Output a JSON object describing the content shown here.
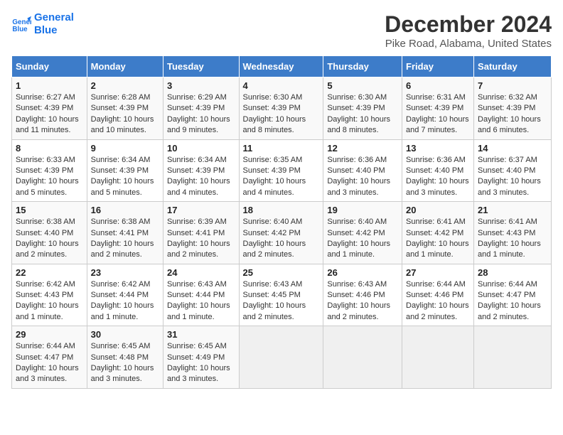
{
  "header": {
    "logo_line1": "General",
    "logo_line2": "Blue",
    "title": "December 2024",
    "subtitle": "Pike Road, Alabama, United States"
  },
  "days_of_week": [
    "Sunday",
    "Monday",
    "Tuesday",
    "Wednesday",
    "Thursday",
    "Friday",
    "Saturday"
  ],
  "weeks": [
    [
      {
        "day": "1",
        "info": "Sunrise: 6:27 AM\nSunset: 4:39 PM\nDaylight: 10 hours and 11 minutes."
      },
      {
        "day": "2",
        "info": "Sunrise: 6:28 AM\nSunset: 4:39 PM\nDaylight: 10 hours and 10 minutes."
      },
      {
        "day": "3",
        "info": "Sunrise: 6:29 AM\nSunset: 4:39 PM\nDaylight: 10 hours and 9 minutes."
      },
      {
        "day": "4",
        "info": "Sunrise: 6:30 AM\nSunset: 4:39 PM\nDaylight: 10 hours and 8 minutes."
      },
      {
        "day": "5",
        "info": "Sunrise: 6:30 AM\nSunset: 4:39 PM\nDaylight: 10 hours and 8 minutes."
      },
      {
        "day": "6",
        "info": "Sunrise: 6:31 AM\nSunset: 4:39 PM\nDaylight: 10 hours and 7 minutes."
      },
      {
        "day": "7",
        "info": "Sunrise: 6:32 AM\nSunset: 4:39 PM\nDaylight: 10 hours and 6 minutes."
      }
    ],
    [
      {
        "day": "8",
        "info": "Sunrise: 6:33 AM\nSunset: 4:39 PM\nDaylight: 10 hours and 5 minutes."
      },
      {
        "day": "9",
        "info": "Sunrise: 6:34 AM\nSunset: 4:39 PM\nDaylight: 10 hours and 5 minutes."
      },
      {
        "day": "10",
        "info": "Sunrise: 6:34 AM\nSunset: 4:39 PM\nDaylight: 10 hours and 4 minutes."
      },
      {
        "day": "11",
        "info": "Sunrise: 6:35 AM\nSunset: 4:39 PM\nDaylight: 10 hours and 4 minutes."
      },
      {
        "day": "12",
        "info": "Sunrise: 6:36 AM\nSunset: 4:40 PM\nDaylight: 10 hours and 3 minutes."
      },
      {
        "day": "13",
        "info": "Sunrise: 6:36 AM\nSunset: 4:40 PM\nDaylight: 10 hours and 3 minutes."
      },
      {
        "day": "14",
        "info": "Sunrise: 6:37 AM\nSunset: 4:40 PM\nDaylight: 10 hours and 3 minutes."
      }
    ],
    [
      {
        "day": "15",
        "info": "Sunrise: 6:38 AM\nSunset: 4:40 PM\nDaylight: 10 hours and 2 minutes."
      },
      {
        "day": "16",
        "info": "Sunrise: 6:38 AM\nSunset: 4:41 PM\nDaylight: 10 hours and 2 minutes."
      },
      {
        "day": "17",
        "info": "Sunrise: 6:39 AM\nSunset: 4:41 PM\nDaylight: 10 hours and 2 minutes."
      },
      {
        "day": "18",
        "info": "Sunrise: 6:40 AM\nSunset: 4:42 PM\nDaylight: 10 hours and 2 minutes."
      },
      {
        "day": "19",
        "info": "Sunrise: 6:40 AM\nSunset: 4:42 PM\nDaylight: 10 hours and 1 minute."
      },
      {
        "day": "20",
        "info": "Sunrise: 6:41 AM\nSunset: 4:42 PM\nDaylight: 10 hours and 1 minute."
      },
      {
        "day": "21",
        "info": "Sunrise: 6:41 AM\nSunset: 4:43 PM\nDaylight: 10 hours and 1 minute."
      }
    ],
    [
      {
        "day": "22",
        "info": "Sunrise: 6:42 AM\nSunset: 4:43 PM\nDaylight: 10 hours and 1 minute."
      },
      {
        "day": "23",
        "info": "Sunrise: 6:42 AM\nSunset: 4:44 PM\nDaylight: 10 hours and 1 minute."
      },
      {
        "day": "24",
        "info": "Sunrise: 6:43 AM\nSunset: 4:44 PM\nDaylight: 10 hours and 1 minute."
      },
      {
        "day": "25",
        "info": "Sunrise: 6:43 AM\nSunset: 4:45 PM\nDaylight: 10 hours and 2 minutes."
      },
      {
        "day": "26",
        "info": "Sunrise: 6:43 AM\nSunset: 4:46 PM\nDaylight: 10 hours and 2 minutes."
      },
      {
        "day": "27",
        "info": "Sunrise: 6:44 AM\nSunset: 4:46 PM\nDaylight: 10 hours and 2 minutes."
      },
      {
        "day": "28",
        "info": "Sunrise: 6:44 AM\nSunset: 4:47 PM\nDaylight: 10 hours and 2 minutes."
      }
    ],
    [
      {
        "day": "29",
        "info": "Sunrise: 6:44 AM\nSunset: 4:47 PM\nDaylight: 10 hours and 3 minutes."
      },
      {
        "day": "30",
        "info": "Sunrise: 6:45 AM\nSunset: 4:48 PM\nDaylight: 10 hours and 3 minutes."
      },
      {
        "day": "31",
        "info": "Sunrise: 6:45 AM\nSunset: 4:49 PM\nDaylight: 10 hours and 3 minutes."
      },
      null,
      null,
      null,
      null
    ]
  ]
}
